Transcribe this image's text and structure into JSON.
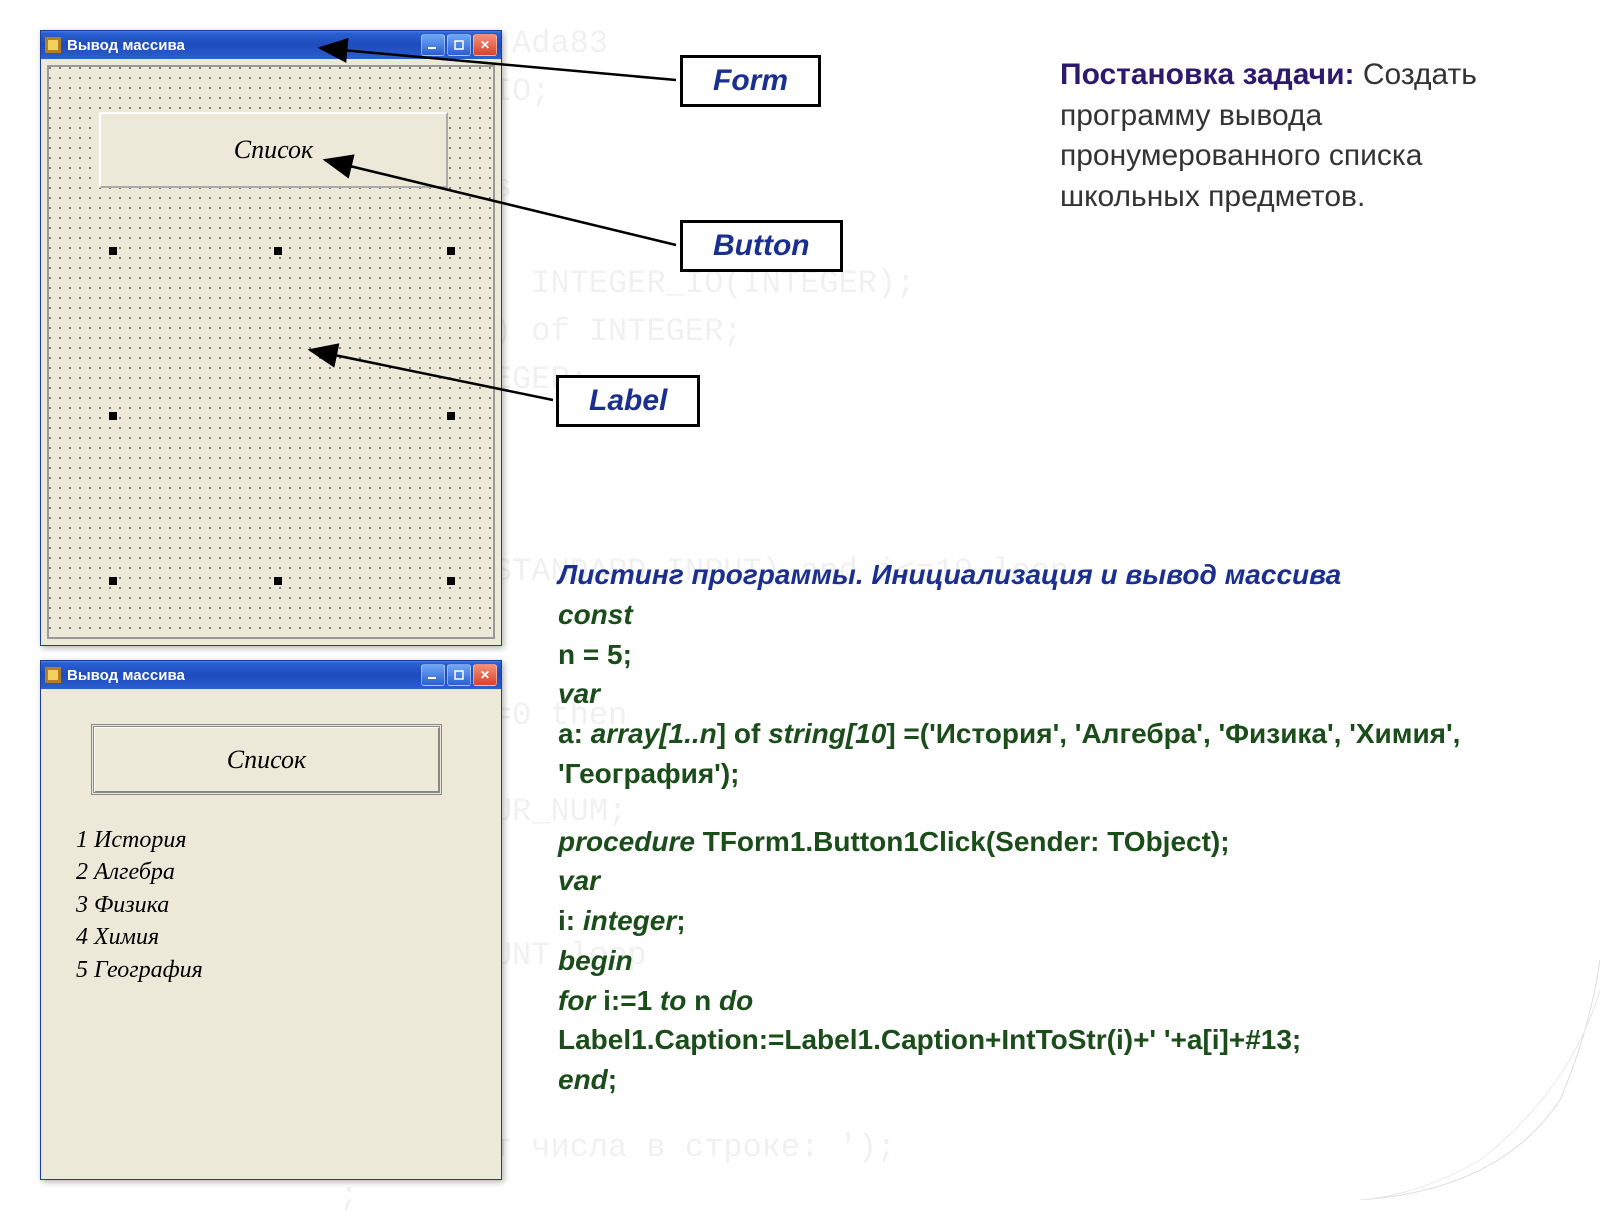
{
  "watermark_code": "  тандарт Ada83\n  e TEXT_IO;\n\n  ample is\n\n  GER is   INTEGER_IO(INTEGER);\n   (1..10) of INTEGER;\n   I: INTEGER;\n\n  on';\n\n OF_FILE(STANDARD_INPUT) and i<=10 loop\n    (I));\n\n  m   2)/=0 then\n OUNT+1;\n OUNT):=CUR_NUM;\n\n\n se 1..COUNT loop\n S(i));\n\n OR =>\n ый формат числа в строке: ');\n ;",
  "designer_window": {
    "title": "Вывод массива",
    "button_label": "Список"
  },
  "runtime_window": {
    "title": "Вывод массива",
    "button_label": "Список",
    "items": [
      "1 История",
      "2 Алгебра",
      "3 Физика",
      "4 Химия",
      "5 География"
    ]
  },
  "callouts": {
    "form": "Form",
    "button": "Button",
    "label": "Label"
  },
  "task": {
    "heading": "Постановка задачи:",
    "body": "Создать программу вывода пронумерованного списка школьных предметов."
  },
  "code": {
    "heading": "Листинг программы. Инициализация и вывод массива",
    "l1_kw": "const",
    "l2": "n = 5;",
    "l3_kw": "var",
    "l4_a": "a: ",
    "l4_b": "array[1..n",
    "l4_c": "] of ",
    "l4_d": "string[10",
    "l4_e": "] =('История', 'Алгебра', 'Физика', 'Химия', 'География');",
    "l5_a": "procedure",
    "l5_b": " TForm1.Button1Click(Sender: TObject);",
    "l6_kw": "var",
    "l7_a": "i: ",
    "l7_b": "integer",
    "l7_c": ";",
    "l8_kw": "begin",
    "l9_a": "for",
    "l9_b": " i:=1 ",
    "l9_c": "to",
    "l9_d": " n ",
    "l9_e": "do",
    "l10": "Label1.Caption:=Label1.Caption+IntToStr(i)+' '+a[i]+#13;",
    "l11_a": "end",
    "l11_b": ";"
  }
}
